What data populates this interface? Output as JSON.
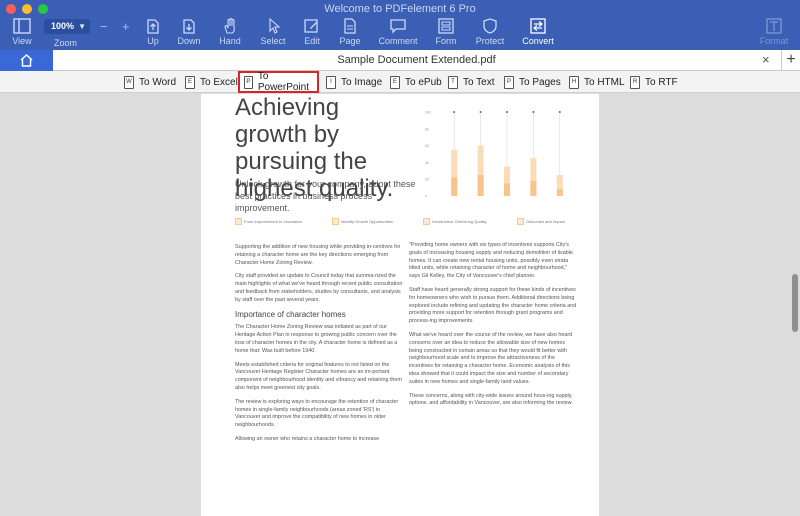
{
  "window": {
    "title": "Welcome to PDFelement 6 Pro"
  },
  "toolbar": {
    "zoom_value": "100%",
    "zoom_label": "Zoom",
    "zoom_minus": "−",
    "zoom_plus": "+",
    "tools": [
      {
        "label": "View",
        "icon": "view-icon"
      },
      {
        "label": "Up",
        "icon": "up-arrow-icon"
      },
      {
        "label": "Down",
        "icon": "down-arrow-icon"
      },
      {
        "label": "Hand",
        "icon": "hand-icon"
      },
      {
        "label": "Select",
        "icon": "select-cursor-icon"
      },
      {
        "label": "Edit",
        "icon": "edit-icon"
      },
      {
        "label": "Page",
        "icon": "page-icon"
      },
      {
        "label": "Comment",
        "icon": "comment-icon"
      },
      {
        "label": "Form",
        "icon": "form-icon"
      },
      {
        "label": "Protect",
        "icon": "protect-icon"
      },
      {
        "label": "Convert",
        "icon": "convert-icon"
      },
      {
        "label": "Format",
        "icon": "format-icon"
      }
    ]
  },
  "tabbar": {
    "home_icon": "home-icon",
    "document_title": "Sample Document Extended.pdf",
    "close": "×",
    "add": "+"
  },
  "convert_options": [
    {
      "label": "To Word",
      "icon_letter": "W"
    },
    {
      "label": "To Excel",
      "icon_letter": "E"
    },
    {
      "label": "To PowerPoint",
      "icon_letter": "P",
      "selected": true
    },
    {
      "label": "To Image",
      "icon_letter": "I"
    },
    {
      "label": "To ePub",
      "icon_letter": "E"
    },
    {
      "label": "To Text",
      "icon_letter": "T"
    },
    {
      "label": "To Pages",
      "icon_letter": "P"
    },
    {
      "label": "To HTML",
      "icon_letter": "H"
    },
    {
      "label": "To RTF",
      "icon_letter": "R"
    }
  ],
  "document": {
    "heading": "Achieving growth by pursuing the highest quality.",
    "lead": "Unlock growth for your company, adopt these best practices in business process improvement.",
    "legend": [
      "From Improvement to Innovation",
      "Identify Growth Opportunities",
      "Introduction: Delivering Quality",
      "Outcomes and Impact"
    ],
    "left_col": [
      "Supporting the addition of new housing while providing in-centives for retaining a character home are the key directions emerging from Character Home Zoning Review.",
      "City staff provided an update to Council today that summa-rized the main highlights of what we've heard through recent public consultation and feedback from stakeholders, studies by consultants, and analysis by staff over the past several years."
    ],
    "left_subheading": "Importance of character homes",
    "left_col_2": [
      "The Character Home Zoning Review was initiated as part of our Heritage Action Plan in response to growing public concern over the loss of character homes in the city. A character home is defined as a home that: Was built before 1940.",
      "Meets established criteria for original features to not listed on the Vancouver Heritage Register Character homes are an im-portant component of neighbourhood identity and vibrancy and retaining them also helps meet greenest city goals.",
      "The review is exploring ways to encourage the retention of character homes in single-family neighbourhoods (areas zoned 'RS') in Vancouver and improve the compatibility of new homes in older neighbourhoods.",
      "Allowing an owner who retains a character home to increase"
    ],
    "right_col": [
      "\"Providing home owners with six types of incentives supports City's goals of increasing housing supply and reducing demolition of livable homes. It can create new rental housing units, possibly even strata titled units, while retaining character of home and neighbourhood,\" says Gil Kelley, the City of Vancouver's chief planner.",
      "Staff have heard generally strong support for these kinds of incentives for homeowners who wish to pursue them. Additional directions being explored include refining and updating the character home criteria and providing more support for retention through grant programs and process-ing improvements.",
      "What we've heard over the course of the review, we have also heard concerns over an idea to reduce the allowable size of new homes being constructed in certain areas so that they would fit better with neighbourhood scale and to improve the attractiveness of the incentives for retaining a character home. Economic analysis of this idea showed that it could impact the size and number of secondary suites in new homes and single-family land values.",
      "These concerns, along with city-wide issues around hous-ing supply, options, and affordability in Vancouver, are also informing the review."
    ]
  },
  "chart_data": {
    "type": "bar",
    "categories": [
      "",
      "",
      "",
      "",
      ""
    ],
    "series": [
      {
        "values": [
          55,
          60,
          35,
          45,
          25
        ]
      },
      {
        "values": [
          22,
          25,
          15,
          18,
          8
        ]
      }
    ],
    "ylim": [
      0,
      100
    ],
    "yticks": [
      "100",
      "80",
      "60",
      "40",
      "20",
      "0"
    ],
    "colors": {
      "light": "#fbdcb6",
      "dark": "#f7c48a",
      "line": "#d9d9d9"
    }
  }
}
